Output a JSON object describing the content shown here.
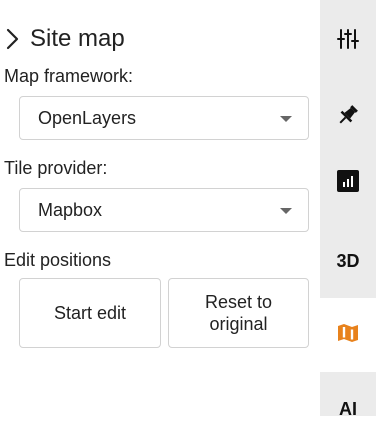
{
  "panel": {
    "section_title": "Site map",
    "map_framework": {
      "label": "Map framework:",
      "selected": "OpenLayers"
    },
    "tile_provider": {
      "label": "Tile provider:",
      "selected": "Mapbox"
    },
    "edit_positions": {
      "label": "Edit positions",
      "start_edit_label": "Start edit",
      "reset_label": "Reset to original"
    }
  },
  "rail": {
    "items": [
      {
        "icon": "sliders-icon"
      },
      {
        "icon": "pin-icon"
      },
      {
        "icon": "bar-chart-icon"
      },
      {
        "label": "3D"
      },
      {
        "icon": "map-icon",
        "active": true
      },
      {
        "label": "AI"
      }
    ],
    "accent_color": "#e8821c"
  }
}
